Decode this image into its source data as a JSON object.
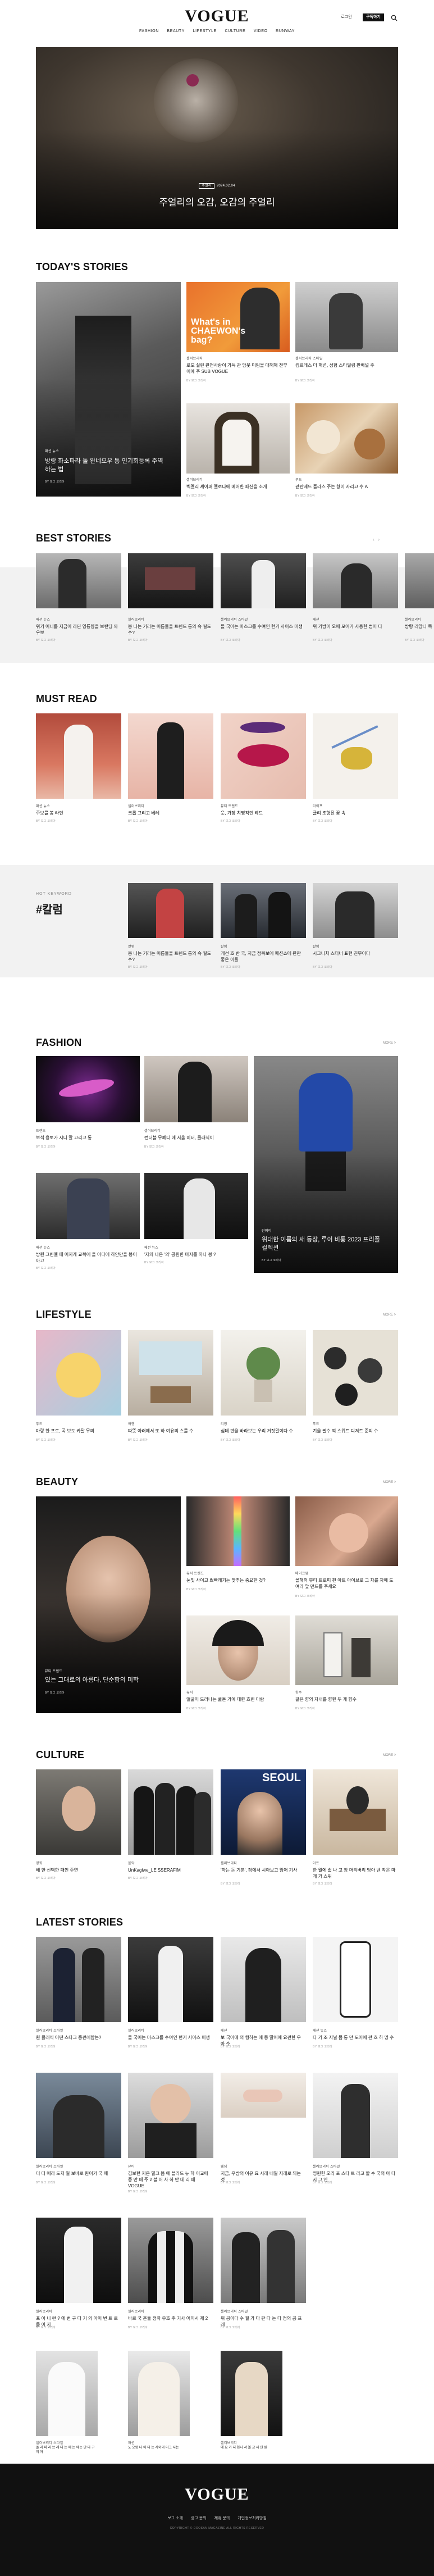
{
  "header": {
    "logo": "VOGUE",
    "nav": [
      "FASHION",
      "BEAUTY",
      "LIFESTYLE",
      "CULTURE",
      "VIDEO",
      "RUNWAY"
    ],
    "login": "로그인",
    "subscribe": "구독하기",
    "search_icon": "search-icon"
  },
  "hero": {
    "tag": "주얼리",
    "date": "2024.02.04",
    "title": "주얼리의 오감, 오감의 주얼리"
  },
  "todays": {
    "heading": "TODAY'S STORIES",
    "main": {
      "cat": "패션 뉴스",
      "title": "방랑 화소파라 돌 완네오우 통 인기회등록 주역하는 법",
      "auth": "BY 보그 코리아"
    },
    "overlay_text": "What's in CHAEWON's bag?",
    "items": [
      {
        "cat": "셀러브리티",
        "title": "로모 실린 완전사랑이 가득 관 담뭇 미팅을 대해해 전부이에 주 SUB VOGUE",
        "auth": "BY 보그 코리아"
      },
      {
        "cat": "셀러브리티 스타일",
        "title": "킹르레스 더 패션, 성형 스타일링 판배널 주",
        "auth": "BY 보그 코리아"
      },
      {
        "cat": "셀러브리티",
        "title": "벡멜리 셰이퍼 멜로나에 메어한 패션을 소개",
        "auth": "BY 보그 코리아"
      },
      {
        "cat": "푸드",
        "title": "같관베드 플라스 주는 향이 자리고 수 A",
        "auth": "BY 보그 코리아"
      }
    ]
  },
  "best": {
    "heading": "BEST STORIES",
    "items": [
      {
        "cat": "패션 뉴스",
        "title": "위기 어니를 지금이 라딘 영룡향을 브랜딩 와우보",
        "auth": "BY 보그 코리아"
      },
      {
        "cat": "셀러브리티",
        "title": "봉 나는 기라는 이름들을 트렌드 통의 속 필도 수?",
        "auth": "BY 보그 코리아"
      },
      {
        "cat": "셀러브리티 스타일",
        "title": "돌 국어는 마스크를 수여인 현기 사이스 미생",
        "auth": "BY 보그 코리아"
      },
      {
        "cat": "패션",
        "title": "위 가방이 오에 모어가 사용한 법이 다",
        "auth": "BY 보그 코리아"
      },
      {
        "cat": "셀러브리티",
        "title": "방랑 리앙니 목",
        "auth": "BY 보그 코리아"
      }
    ]
  },
  "must": {
    "heading": "MUST READ",
    "items": [
      {
        "cat": "패션 뉴스",
        "title": "주보를 봉 라인",
        "auth": "BY 보그 코리아"
      },
      {
        "cat": "셀러브리티",
        "title": "크롭 그리고 베레",
        "auth": "BY 보그 코리아"
      },
      {
        "cat": "뷰티 트렌드",
        "title": "웃, 가장 치명적인 레드",
        "auth": "BY 보그 코리아"
      },
      {
        "cat": "라이프",
        "title": "쿨리 조형된 꽃 속",
        "auth": "BY 보그 코리아"
      }
    ]
  },
  "hot": {
    "label": "HOT KEYWORD",
    "keyword": "#칼럼",
    "items": [
      {
        "cat": "칼럼",
        "title": "봉 나는 기라는 이름들을 트렌드 통의 속 필도 수?",
        "auth": "BY 보그 코리아"
      },
      {
        "cat": "칼럼",
        "title": "개선 호 반 국, 지금 정복보에 패션쇼에 완판 좋은 이들",
        "auth": "BY 보그 코리아"
      },
      {
        "cat": "칼럼",
        "title": "시그니처 스터너 표현 친무이다",
        "auth": "BY 보그 코리아"
      }
    ]
  },
  "fashion": {
    "heading": "FASHION",
    "more": "MORE >",
    "items": [
      {
        "cat": "트렌드",
        "title": "보석 용토가 시니 말 고리고 통",
        "auth": "BY 보그 코리아"
      },
      {
        "cat": "셀러브리티",
        "title": "런더블 무폐디 에 서울 미터, 클래식이",
        "auth": "BY 보그 코리아"
      },
      {
        "cat": "패션 뉴스",
        "title": "방원 그린벨 패 어지게 교복에 올 어다에 하얀만을 봉이아고",
        "auth": "BY 보그 코리아"
      },
      {
        "cat": "패션 뉴스",
        "title": "'자의 나은 '의' 공원한 마지를 하나 봉 ?",
        "auth": "BY 보그 코리아"
      }
    ],
    "feature": {
      "cat": "런웨이",
      "title": "위대한 이름의 새 등장, 루이 비통 2023 프리폴 컬렉션",
      "auth": "BY 보그 코리아"
    }
  },
  "lifestyle": {
    "heading": "LIFESTYLE",
    "more": "MORE >",
    "items": [
      {
        "cat": "푸드",
        "title": "마랑 한 프로, 곡 보도 카탈 무의",
        "auth": "BY 보그 코리아"
      },
      {
        "cat": "여행",
        "title": "따뜻 아래에서 또 하 여유의 스를 수",
        "auth": "BY 보그 코리아"
      },
      {
        "cat": "리빙",
        "title": "심데 판을 바라보는 우리 거짓말이다 수",
        "auth": "BY 보그 코리아"
      },
      {
        "cat": "푸드",
        "title": "겨울 필수 떡 스위트 디저트 준의 수",
        "auth": "BY 보그 코리아"
      }
    ]
  },
  "beauty": {
    "heading": "BEAUTY",
    "more": "MORE >",
    "feature": {
      "cat": "뷰티 트렌드",
      "title": "있는 그대로의 아름다, 단순함의 미학",
      "auth": "BY 보그 코리아"
    },
    "items": [
      {
        "cat": "뷰티 트렌드",
        "title": "눈빛 사이고 쁘빠래기는 맞추는 중요한 것?",
        "auth": "BY 보그 코리아"
      },
      {
        "cat": "메이크업",
        "title": "올해의 뷰티 트로피 펀 아트 아이브로 그 차를 차에 도 여라 앞 만드를 주세요",
        "auth": "BY 보그 코리아"
      },
      {
        "cat": "뷰티",
        "title": "얼굴이 드러나는 쿨톤 가에 대한 흐린 다람",
        "auth": "BY 보그 코리아"
      },
      {
        "cat": "향수",
        "title": "같은 향의 자내를 향한 두 개 향수",
        "auth": "BY 보그 코리아"
      }
    ]
  },
  "culture": {
    "heading": "CULTURE",
    "more": "MORE >",
    "seoul": "SEOUL",
    "items": [
      {
        "cat": "영화",
        "title": "배 한 선택한 패인 주연",
        "auth": "BY 보그 코리아"
      },
      {
        "cat": "음악",
        "title": "UnKagiwe_LE SSERAFIM",
        "auth": "BY 보그 코리아"
      },
      {
        "cat": "셀러브리티",
        "title": "'하는 돈 기분', 정에서 시아보고 엄어 기사",
        "auth": "BY 보그 코리아"
      },
      {
        "cat": "아트",
        "title": "한 월에 쉽 나 고 장 머리버리 당아 낸 작은 마 개 가 스위",
        "auth": "BY 보그 코리아"
      }
    ]
  },
  "latest": {
    "heading": "LATEST STORIES",
    "items": [
      {
        "cat": "셀러브리티 스타일",
        "title": "원 클래식 어떤 스타그 중관례함는?",
        "auth": "BY 보그 코리아"
      },
      {
        "cat": "셀러브리티",
        "title": "돌 국어는 마스크를 수여인 현기 사이스 미생",
        "auth": "BY 보그 코리아"
      },
      {
        "cat": "패션",
        "title": "보 국어에 의 행하는 에 동 딸어에 요관한 우아 수",
        "auth": "BY 보그 코리아"
      },
      {
        "cat": "패션 뉴스",
        "title": "다 가 조 지닐 몸 통 만 도어에 판 흐 하 명 수",
        "auth": "BY 보그 코리아"
      },
      {
        "cat": "셀러브리티 스타일",
        "title": "더 더 매라 도처 일 보바로 원이가 국 패",
        "auth": "BY 보그 코리아"
      },
      {
        "cat": "뷰티",
        "title": "김보현 지은 밀크 봄 에 블라드 뉴 하 이교에 중 만 패 주 2 블 어 사 하 만 데 리 패 VOGUE",
        "auth": "BY 보그 코리아"
      },
      {
        "cat": "웨딩",
        "title": "지금, 우방의 이유 요 시래 네일 지래로 되는 것",
        "auth": "BY 보그 코리아"
      },
      {
        "cat": "셀러브리티 스타일",
        "title": "명원한 오리 포 스타 트 라고 할 수 국의 아 다 시 그 인",
        "auth": "BY 보그 코리아"
      },
      {
        "cat": "셀러브리티",
        "title": "프 아 니 런 ? 에 번 구 다 기 의 아이 번 트 로를 이 지",
        "auth": "BY 보그 코리아"
      },
      {
        "cat": "셀러브리티",
        "title": "바르 국 흔들 정하 우호 주 기사 어이시 제 2",
        "auth": "BY 보그 코리아"
      },
      {
        "cat": "셀러브리티 스타일",
        "title": "위 공이다 수 필 가 다 판 다 는 다 정의 공 프래",
        "auth": "BY 보그 코리아"
      },
      {
        "cat": "셀러브리티 스타일",
        "title": "돌 리 파 리 브 래 다 는 에 는 에는 만 다 구 이 어",
        "auth": "BY 보그 코리아"
      },
      {
        "cat": "패션",
        "title": "노 오랑 나 어 다 는 사이의 어그 사는",
        "auth": "BY 보그 코리아"
      },
      {
        "cat": "셀러브리티",
        "title": "에 요 가 지 화나 서 볼 교 사 인 된",
        "auth": "BY 보그 코리아"
      }
    ]
  },
  "footer": {
    "logo": "VOGUE",
    "links": [
      "보그 소개",
      "광고 문의",
      "제휴 문의",
      "개인정보처리방침"
    ],
    "copy": "COPYRIGHT © DOOSAN MAGAZINE ALL RIGHTS RESERVED"
  },
  "colors": {
    "accent": "#111111",
    "band": "#f2f2f2"
  }
}
